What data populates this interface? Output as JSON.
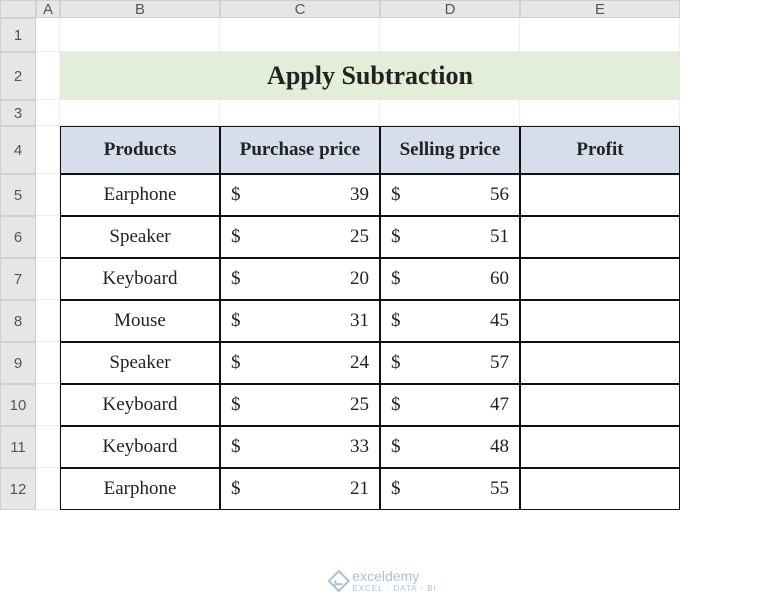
{
  "cols": [
    "A",
    "B",
    "C",
    "D",
    "E"
  ],
  "rows": [
    "1",
    "2",
    "3",
    "4",
    "5",
    "6",
    "7",
    "8",
    "9",
    "10",
    "11",
    "12"
  ],
  "title": "Apply Subtraction",
  "headers": {
    "products": "Products",
    "purchase": "Purchase price",
    "selling": "Selling price",
    "profit": "Profit"
  },
  "currency": "$",
  "rows_data": [
    {
      "product": "Earphone",
      "purchase": 39,
      "selling": 56,
      "profit": ""
    },
    {
      "product": "Speaker",
      "purchase": 25,
      "selling": 51,
      "profit": ""
    },
    {
      "product": "Keyboard",
      "purchase": 20,
      "selling": 60,
      "profit": ""
    },
    {
      "product": "Mouse",
      "purchase": 31,
      "selling": 45,
      "profit": ""
    },
    {
      "product": "Speaker",
      "purchase": 24,
      "selling": 57,
      "profit": ""
    },
    {
      "product": "Keyboard",
      "purchase": 25,
      "selling": 47,
      "profit": ""
    },
    {
      "product": "Keyboard",
      "purchase": 33,
      "selling": 48,
      "profit": ""
    },
    {
      "product": "Earphone",
      "purchase": 21,
      "selling": 55,
      "profit": ""
    }
  ],
  "watermark": {
    "brand": "exceldemy",
    "tagline": "EXCEL · DATA · BI"
  },
  "chart_data": {
    "type": "table",
    "title": "Apply Subtraction",
    "columns": [
      "Products",
      "Purchase price",
      "Selling price",
      "Profit"
    ],
    "rows": [
      [
        "Earphone",
        39,
        56,
        null
      ],
      [
        "Speaker",
        25,
        51,
        null
      ],
      [
        "Keyboard",
        20,
        60,
        null
      ],
      [
        "Mouse",
        31,
        45,
        null
      ],
      [
        "Speaker",
        24,
        57,
        null
      ],
      [
        "Keyboard",
        25,
        47,
        null
      ],
      [
        "Keyboard",
        33,
        48,
        null
      ],
      [
        "Earphone",
        21,
        55,
        null
      ]
    ]
  }
}
